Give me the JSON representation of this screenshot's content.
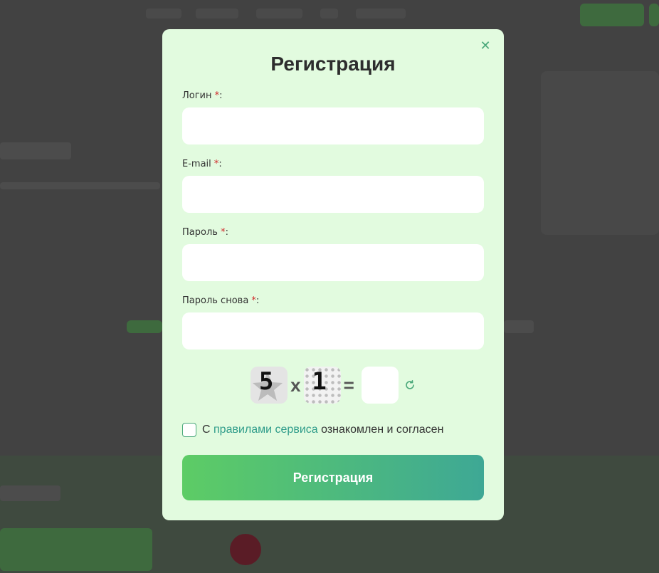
{
  "modal": {
    "title": "Регистрация",
    "close_icon": "close-icon",
    "fields": [
      {
        "label": "Логин",
        "required_mark": "*",
        "suffix": ":",
        "value": "",
        "placeholder": ""
      },
      {
        "label": "E-mail",
        "required_mark": "*",
        "suffix": ":",
        "value": "",
        "placeholder": ""
      },
      {
        "label": "Пароль",
        "required_mark": "*",
        "suffix": ":",
        "value": "",
        "placeholder": ""
      },
      {
        "label": "Пароль снова",
        "required_mark": "*",
        "suffix": ":",
        "value": "",
        "placeholder": ""
      }
    ],
    "captcha": {
      "operand1": "5",
      "operator": "x",
      "operand2": "1",
      "equals": "=",
      "answer": "",
      "refresh_icon": "refresh-icon"
    },
    "agreement": {
      "prefix": "С ",
      "link_text": "правилами сервиса",
      "suffix": " ознакомлен и согласен",
      "checked": false
    },
    "submit_label": "Регистрация"
  },
  "colors": {
    "modal_bg": "#e2fbdf",
    "accent": "#4aa87a",
    "button_gradient_start": "#5dcc65",
    "button_gradient_end": "#3ea895",
    "required": "#d12a2a",
    "overlay": "#424242"
  }
}
